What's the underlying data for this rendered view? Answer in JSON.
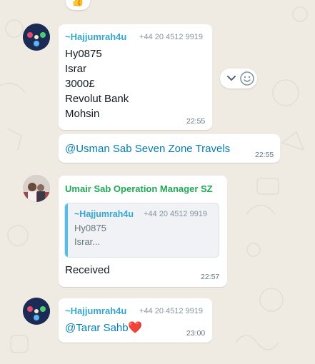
{
  "colors": {
    "wallpaper": "#efeae2",
    "sender_blue": "#35a7cf",
    "sender_green": "#1fa855",
    "mention": "#027eb5",
    "quote_bar": "#53bdeb"
  },
  "top_reaction": {
    "emoji": "👍"
  },
  "messages": [
    {
      "sender": "~Hajjumrah4u",
      "phone": "+44 20 4512 9919",
      "lines": [
        "Hy0875",
        "Israr",
        "3000£",
        "Revolut Bank",
        "Mohsin"
      ],
      "time": "22:55",
      "avatar_icon": "group-avatar-icon",
      "hover_controls": {
        "icons": [
          "chevron-down-icon",
          "emoji-smile-icon"
        ]
      }
    },
    {
      "mention": "@Usman Sab Seven Zone Travels",
      "time": "22:55"
    },
    {
      "sender": "Umair Sab Operation Manager SZ",
      "quoted": {
        "sender": "~Hajjumrah4u",
        "phone": "+44 20 4512 9919",
        "lines": [
          "Hy0875",
          "Israr..."
        ]
      },
      "text": "Received",
      "time": "22:57",
      "avatar_icon": "person-avatar-icon"
    },
    {
      "sender": "~Hajjumrah4u",
      "phone": "+44 20 4512 9919",
      "mention": "@Tarar Sahb",
      "emoji": "❤️",
      "time": "23:00",
      "avatar_icon": "group-avatar-icon"
    }
  ]
}
